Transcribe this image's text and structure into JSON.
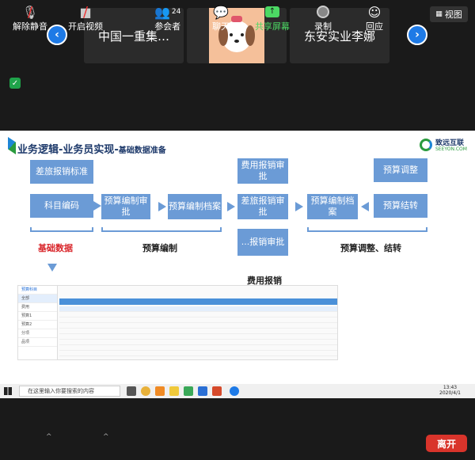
{
  "top": {
    "participant_left": "中国一重集…",
    "participant_right": "东安实业李娜",
    "view_label": "视图"
  },
  "slide": {
    "title_main": "业务逻辑-业务员实现-",
    "title_sub": "基础数据准备",
    "brand_cn": "致远互联",
    "brand_en": "SEEYON.COM",
    "boxes": {
      "travel_standard": "差旅报销标准",
      "subject_code": "科目编码",
      "budget_review": "预算编制审批",
      "budget_archive": "预算编制档案",
      "expense_review": "费用报销审批",
      "travel_review": "差旅报销审批",
      "misc_review": "...报销审批",
      "budget_archive2": "预算编制档案",
      "budget_adjust": "预算调整",
      "budget_carry": "预算结转"
    },
    "labels": {
      "basic_data": "基础数据",
      "budget_prep": "预算编制",
      "budget_adjust_carry": "预算调整、结转",
      "expense": "费用报销"
    },
    "shot_side_items": [
      "预算科目",
      "全部",
      "费用",
      "预算1",
      "预算2",
      "分项",
      "品项"
    ]
  },
  "taskbar": {
    "search_placeholder": "在这里输入你要搜索的内容",
    "time": "13:43",
    "date": "2020/4/1"
  },
  "toolbar": {
    "mute": "解除静音",
    "video": "开启视频",
    "participants": "参会者",
    "participants_count": "24",
    "chat": "聊天",
    "share": "共享屏幕",
    "record": "录制",
    "reactions": "回应",
    "leave": "离开"
  }
}
